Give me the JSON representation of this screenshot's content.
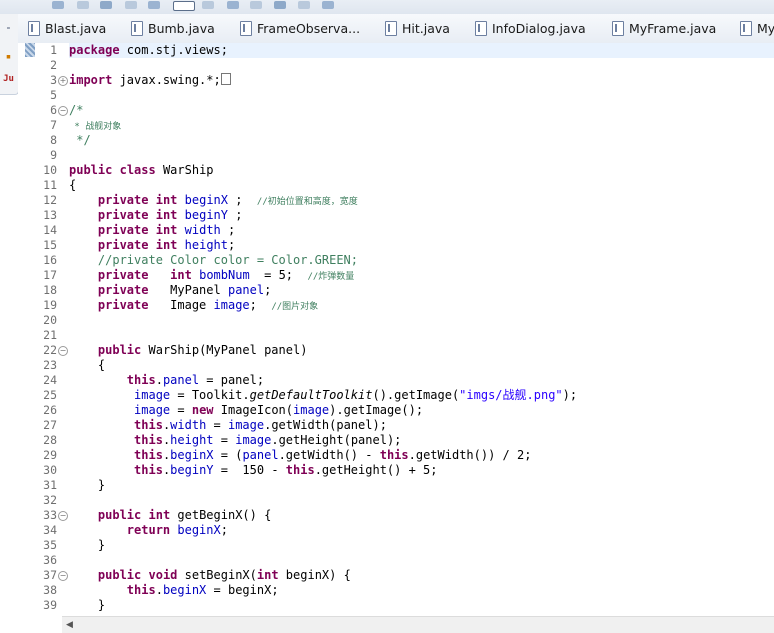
{
  "tabs": [
    {
      "label": "Blast.java"
    },
    {
      "label": "Bumb.java"
    },
    {
      "label": "FrameObserva..."
    },
    {
      "label": "Hit.java"
    },
    {
      "label": "InfoDialog.java"
    },
    {
      "label": "MyFrame.java"
    },
    {
      "label": "My"
    }
  ],
  "icons": {
    "file": "java-file-icon",
    "fold_collapsed": "fold-expand-icon",
    "fold_expanded": "fold-collapse-icon"
  },
  "colors": {
    "keyword": "#7f0055",
    "comment": "#3f7f5f",
    "field": "#0000c0",
    "string": "#2a00ff",
    "current_line": "#e8f2fe"
  },
  "code": {
    "l1_pkg": "package",
    "l1_name": " com.stj.views;",
    "l3_import": "import",
    "l3_rest": " javax.swing.*;",
    "l6": "/*",
    "l7": " * 战舰对象",
    "l8": " */",
    "l10_public": "public",
    "l10_class": "class",
    "l10_name": " WarShip",
    "l11": "{",
    "priv": "private",
    "int": "int",
    "l12_field": "beginX",
    "l12_semi": " ;  ",
    "l12_comment": "//初始位置和高度，宽度",
    "l13_field": "beginY",
    "l13_semi": " ;",
    "l14_field": "width",
    "l14_semi": " ;",
    "l15_field": "height",
    "l15_semi": ";",
    "l16": "//private Color color = Color.GREEN;",
    "l17_field": "bombNum",
    "l17_rest": "  = 5;  ",
    "l17_comment": "//炸弹数量",
    "l18_type": "   MyPanel ",
    "l18_field": "panel",
    "l18_semi": ";",
    "l19_type": "   Image ",
    "l19_field": "image",
    "l19_semi": ";  ",
    "l19_comment": "//图片对象",
    "l22_public": "public",
    "l22_sig": " WarShip(MyPanel panel)",
    "l23": "{",
    "this": "this",
    "l24_field": "panel",
    "l24_rest": " = panel;",
    "l25_a": " image",
    "l25_b": " = Toolkit.",
    "l25_c": "getDefaultToolkit",
    "l25_d": "().getImage(",
    "l25_e": "\"imgs/战舰.png\"",
    "l25_f": ");",
    "l26_a": " image",
    "l26_b": " = ",
    "l26_new": "new",
    "l26_c": " ImageIcon(",
    "l26_d": "image",
    "l26_e": ").getImage();",
    "l27_field": "width",
    "l27_b": " = ",
    "l27_c": "image",
    "l27_d": ".getWidth(panel);",
    "l28_field": "height",
    "l28_b": " = ",
    "l28_c": "image",
    "l28_d": ".getHeight(panel);",
    "l29_field": "beginX",
    "l29_b": " = (",
    "l29_c": "panel",
    "l29_d": ".getWidth() - ",
    "l29_e": ".getWidth()) / 2;",
    "l30_field": "beginY",
    "l30_b": " =  150 - ",
    "l30_c": ".getHeight() + 5;",
    "l31": "}",
    "l33_public": "public",
    "l33_int": "int",
    "l33_rest": " getBeginX() {",
    "l34_return": "return",
    "l34_field": " beginX",
    "l34_semi": ";",
    "l35": "}",
    "l37_public": "public",
    "l37_void": "void",
    "l37_rest": " setBeginX(",
    "l37_int": "int",
    "l37_end": " beginX) {",
    "l38_field": "beginX",
    "l38_rest": " = beginX;",
    "l39": "}"
  },
  "line_numbers": [
    "1",
    "2",
    "3",
    "5",
    "6",
    "7",
    "8",
    "9",
    "10",
    "11",
    "12",
    "13",
    "14",
    "15",
    "16",
    "17",
    "18",
    "19",
    "20",
    "21",
    "22",
    "23",
    "24",
    "25",
    "26",
    "27",
    "28",
    "29",
    "30",
    "31",
    "32",
    "33",
    "34",
    "35",
    "36",
    "37",
    "38",
    "39"
  ]
}
